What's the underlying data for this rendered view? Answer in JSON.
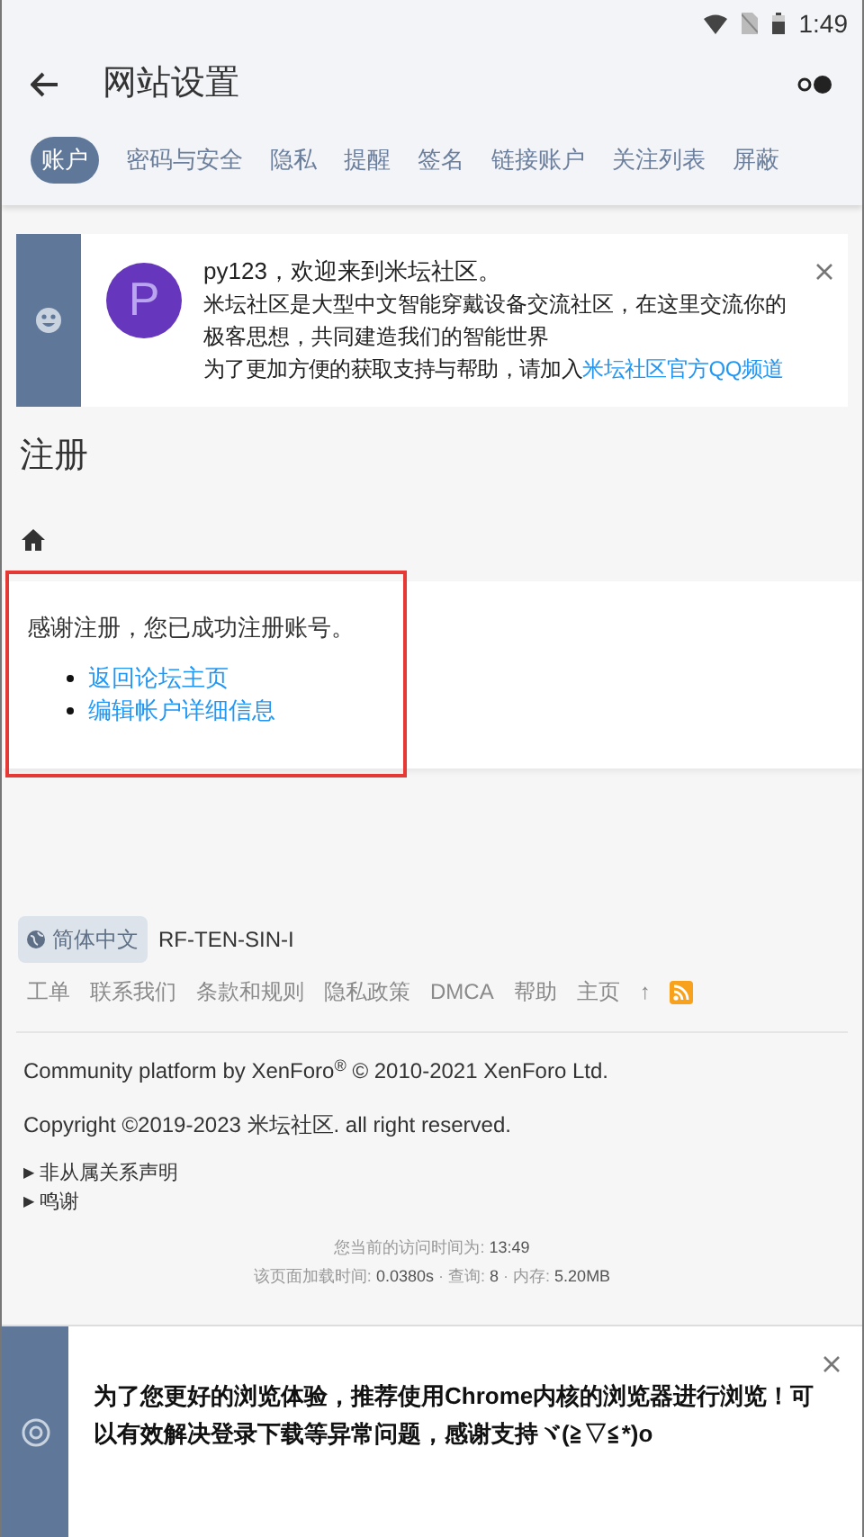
{
  "status_bar": {
    "time": "1:49"
  },
  "app_bar": {
    "title": "网站设置"
  },
  "tabs": [
    {
      "label": "账户",
      "selected": true
    },
    {
      "label": "密码与安全",
      "selected": false
    },
    {
      "label": "隐私",
      "selected": false
    },
    {
      "label": "提醒",
      "selected": false
    },
    {
      "label": "签名",
      "selected": false
    },
    {
      "label": "链接账户",
      "selected": false
    },
    {
      "label": "关注列表",
      "selected": false
    },
    {
      "label": "屏蔽",
      "selected": false
    }
  ],
  "welcome_notice": {
    "avatar_letter": "P",
    "greeting": "py123，欢迎来到米坛社区。",
    "description": "米坛社区是大型中文智能穿戴设备交流社区，在这里交流你的极客思想，共同建造我们的智能世界",
    "join_text": "为了更加方便的获取支持与帮助，请加入",
    "join_link": "米坛社区官方QQ频道"
  },
  "page_title": "注册",
  "message": {
    "highlighted": true,
    "text": "感谢注册，您已成功注册账号。",
    "links": [
      "返回论坛主页",
      "编辑帐户详细信息"
    ]
  },
  "footer": {
    "language": "简体中文",
    "style": "RF-TEN-SIN-I",
    "links": [
      {
        "kind": "text",
        "label": "工单"
      },
      {
        "kind": "text",
        "label": "联系我们"
      },
      {
        "kind": "text",
        "label": "条款和规则"
      },
      {
        "kind": "text",
        "label": "隐私政策"
      },
      {
        "kind": "text",
        "label": "DMCA"
      },
      {
        "kind": "text",
        "label": "帮助"
      },
      {
        "kind": "text",
        "label": "主页"
      },
      {
        "kind": "text",
        "label": "↑"
      },
      {
        "kind": "rss"
      }
    ],
    "platform": "Community platform by XenForo$^{®}$ © 2010-2021 XenForo Ltd.",
    "copyright": "Copyright ©2019-2023 米坛社区. all right reserved.",
    "disclosures": [
      {
        "marker": "▶",
        "label": "非从属关系声明"
      },
      {
        "marker": "▶",
        "label": "鸣谢"
      }
    ],
    "visit_time": {
      "label": "您当前的访问时间为:",
      "value": "13:49"
    },
    "stats": [
      {
        "label": "该页面加载时间:",
        "value": "0.0380s"
      },
      {
        "separator": "·",
        "label": "查询:",
        "value": "8"
      },
      {
        "separator": "·",
        "label": "内存:",
        "value": "5.20MB"
      }
    ]
  },
  "browser_notice": {
    "text": "为了您更好的浏览体验，推荐使用Chrome内核的浏览器进行浏览！可以有效解决登录下载等异常问题，感谢支持ヾ(≧▽≦*)o"
  }
}
